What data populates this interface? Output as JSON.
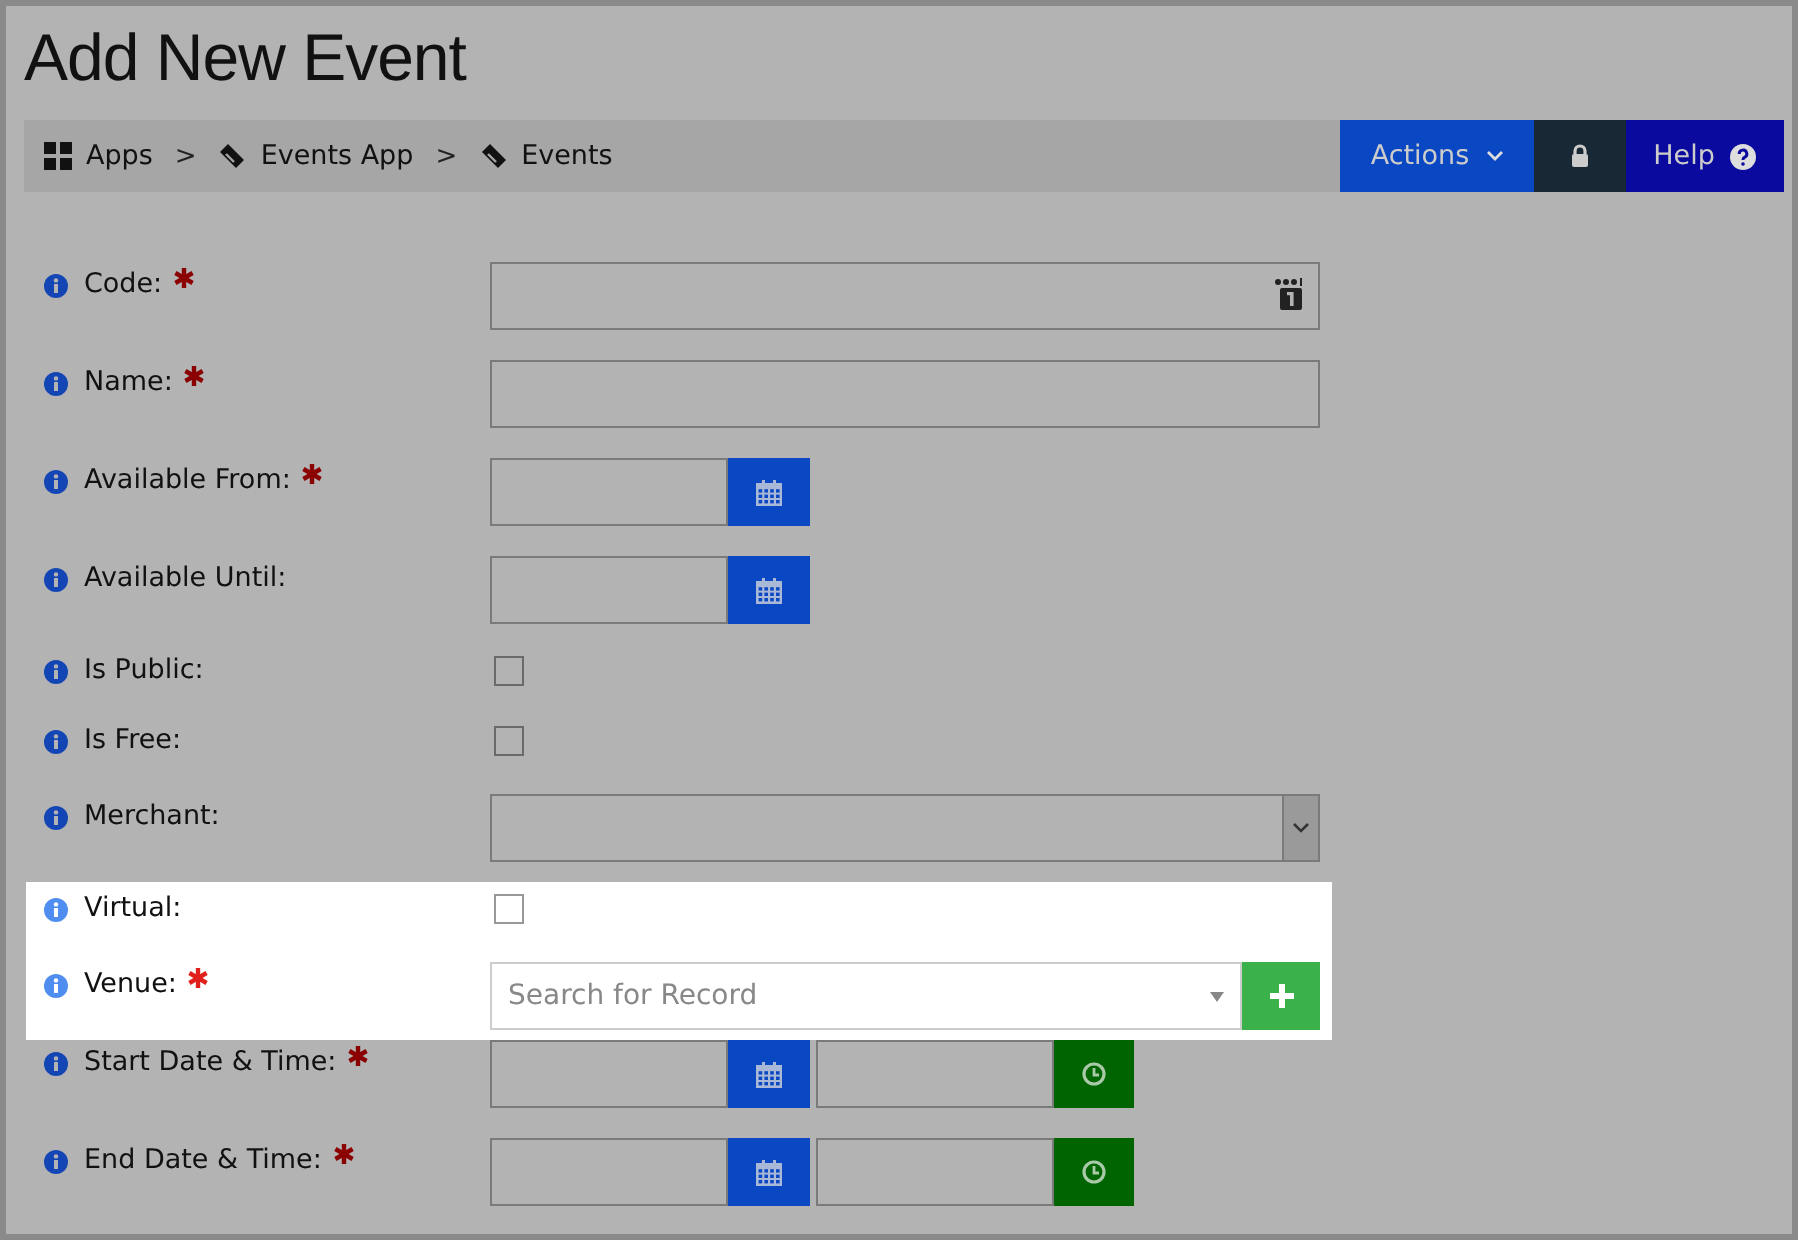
{
  "page_title": "Add New Event",
  "breadcrumbs": [
    {
      "label": "Apps",
      "kind": "grid"
    },
    {
      "label": "Events App",
      "kind": "ticket"
    },
    {
      "label": "Events",
      "kind": "ticket"
    }
  ],
  "breadcrumb_separator": ">",
  "toolbar": {
    "actions": "Actions",
    "help": "Help"
  },
  "fields": [
    {
      "label": "Code:",
      "kind": "code",
      "required": true,
      "highlighted": false
    },
    {
      "label": "Name:",
      "kind": "text",
      "required": true,
      "highlighted": false
    },
    {
      "label": "Available From:",
      "kind": "date",
      "required": true,
      "highlighted": false
    },
    {
      "label": "Available Until:",
      "kind": "date",
      "required": false,
      "highlighted": false
    },
    {
      "label": "Is Public:",
      "kind": "checkbox",
      "checked": false,
      "required": false,
      "highlighted": false
    },
    {
      "label": "Is Free:",
      "kind": "checkbox",
      "checked": false,
      "required": false,
      "highlighted": false
    },
    {
      "label": "Merchant:",
      "kind": "select",
      "required": false,
      "highlighted": false
    },
    {
      "label": "Virtual:",
      "kind": "checkbox",
      "checked": false,
      "required": false,
      "highlighted": true
    },
    {
      "label": "Venue:",
      "kind": "search",
      "placeholder": "Search for Record",
      "required": true,
      "highlighted": true
    },
    {
      "label": "Start Date & Time:",
      "kind": "datetime",
      "required": true,
      "highlighted": false
    },
    {
      "label": "End Date & Time:",
      "kind": "datetime",
      "required": true,
      "highlighted": false
    }
  ]
}
